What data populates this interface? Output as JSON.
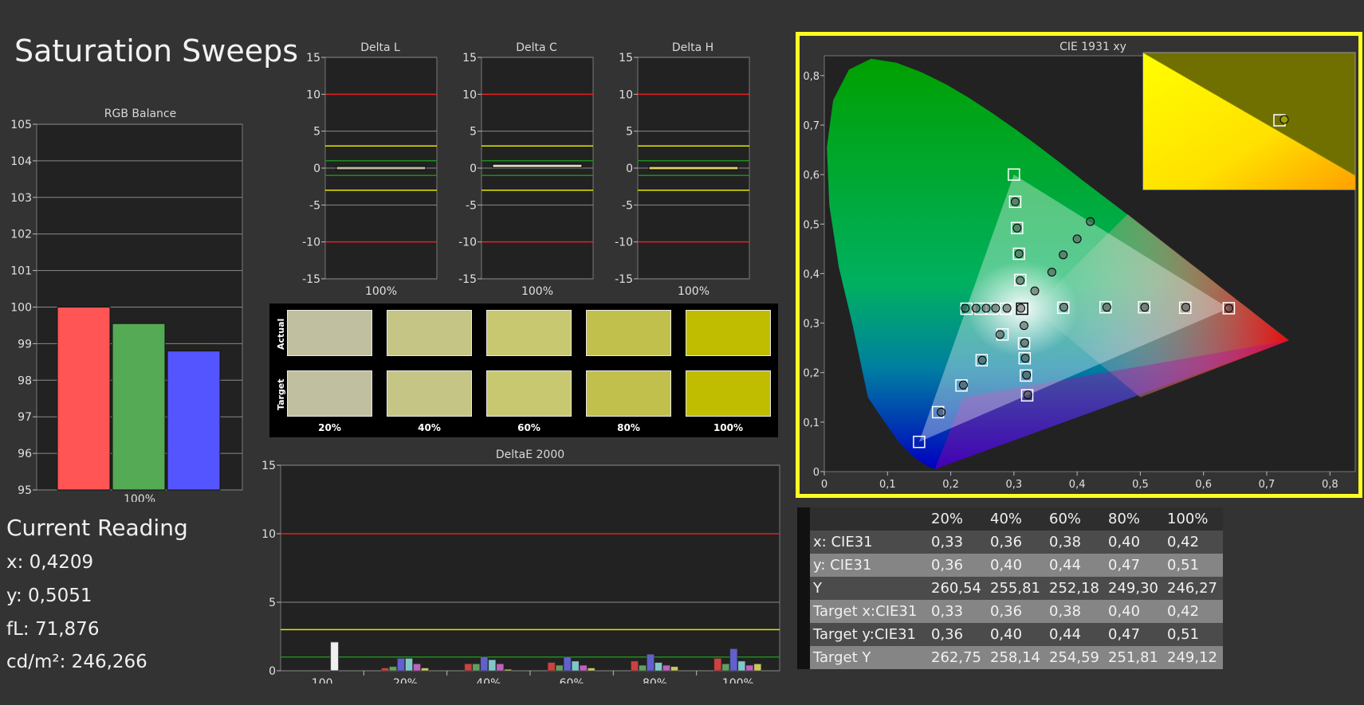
{
  "page": {
    "title": "Saturation Sweeps"
  },
  "colors": {
    "background": "#333333",
    "plot_background": "#222222",
    "highlight_border": "#ffff22",
    "red_limit": "#e02020",
    "yellow_limit": "#e6e600",
    "green_limit": "#1e8c1e"
  },
  "rgb_balance": {
    "title": "RGB Balance",
    "y_ticks": [
      "105",
      "104",
      "103",
      "102",
      "101",
      "100",
      "99",
      "98",
      "97",
      "96",
      "95"
    ],
    "x_label": "100%",
    "chart_data": {
      "type": "bar",
      "categories": [
        "R",
        "G",
        "B"
      ],
      "values": [
        100.0,
        99.55,
        98.8
      ],
      "colors": [
        "#ff5555",
        "#55aa55",
        "#5555ff"
      ],
      "ylim": [
        95,
        105
      ]
    }
  },
  "delta_charts": [
    {
      "title": "Delta L",
      "x_label": "100%",
      "chart_data": {
        "type": "bar",
        "categories": [
          "100%"
        ],
        "values": [
          0.0
        ],
        "bar_color": "#b8b8a0",
        "ylim": [
          -15,
          15
        ]
      }
    },
    {
      "title": "Delta C",
      "x_label": "100%",
      "chart_data": {
        "type": "bar",
        "categories": [
          "100%"
        ],
        "values": [
          0.3
        ],
        "bar_color": "#d8d8c0",
        "ylim": [
          -15,
          15
        ]
      }
    },
    {
      "title": "Delta H",
      "x_label": "100%",
      "chart_data": {
        "type": "bar",
        "categories": [
          "100%"
        ],
        "values": [
          0.0
        ],
        "bar_color": "#d8d060",
        "ylim": [
          -15,
          15
        ]
      }
    }
  ],
  "delta_ticks": [
    "15",
    "10",
    "5",
    "0",
    "-5",
    "-10",
    "-15"
  ],
  "swatches": {
    "actual_label": "Actual",
    "target_label": "Target",
    "labels": [
      "20%",
      "40%",
      "60%",
      "80%",
      "100%"
    ],
    "actual_colors": [
      "#c0c0a0",
      "#c5c585",
      "#c8c870",
      "#c2c04d",
      "#c0bc00"
    ],
    "target_colors": [
      "#c0c0a0",
      "#c5c585",
      "#c8c870",
      "#c2c04d",
      "#c0bc00"
    ]
  },
  "deltae": {
    "title": "DeltaE 2000",
    "y_ticks": [
      "15",
      "10",
      "5",
      "0"
    ],
    "chart_data": {
      "type": "bar",
      "ylim": [
        0,
        15
      ],
      "categories": [
        "100",
        "20%",
        "40%",
        "60%",
        "80%",
        "100%"
      ],
      "series": [
        {
          "name": "White",
          "color": "#f0f0f0",
          "values": [
            2.1,
            null,
            null,
            null,
            null,
            null
          ]
        },
        {
          "name": "Red",
          "color": "#d04040",
          "values": [
            null,
            0.2,
            0.5,
            0.6,
            0.7,
            0.9
          ]
        },
        {
          "name": "Green",
          "color": "#60a060",
          "values": [
            null,
            0.3,
            0.5,
            0.4,
            0.4,
            0.5
          ]
        },
        {
          "name": "Blue",
          "color": "#6060d0",
          "values": [
            null,
            0.9,
            1.0,
            1.0,
            1.2,
            1.6
          ]
        },
        {
          "name": "Cyan",
          "color": "#80c8c8",
          "values": [
            null,
            0.9,
            0.8,
            0.7,
            0.6,
            0.7
          ]
        },
        {
          "name": "Magenta",
          "color": "#c060c0",
          "values": [
            null,
            0.5,
            0.5,
            0.4,
            0.4,
            0.4
          ]
        },
        {
          "name": "Yellow",
          "color": "#c8c860",
          "values": [
            null,
            0.2,
            0.1,
            0.2,
            0.3,
            0.5
          ]
        }
      ]
    }
  },
  "current_reading": {
    "heading": "Current Reading",
    "x": "x: 0,4209",
    "y": "y: 0,5051",
    "fl": "fL: 71,876",
    "cdm2": "cd/m²: 246,266"
  },
  "cie": {
    "title": "CIE 1931 xy",
    "x_ticks": [
      "0",
      "0,1",
      "0,2",
      "0,3",
      "0,4",
      "0,5",
      "0,6",
      "0,7",
      "0,8"
    ],
    "y_ticks": [
      "0",
      "0,1",
      "0,2",
      "0,3",
      "0,4",
      "0,5",
      "0,6",
      "0,7",
      "0,8"
    ],
    "chart_data": {
      "type": "scatter",
      "xlim": [
        0,
        0.84
      ],
      "ylim": [
        0,
        0.84
      ],
      "gamut": [
        [
          0.64,
          0.33
        ],
        [
          0.3,
          0.6
        ],
        [
          0.15,
          0.06
        ]
      ],
      "white": [
        0.313,
        0.329
      ],
      "targets": [
        [
          0.64,
          0.33
        ],
        [
          0.571,
          0.331
        ],
        [
          0.506,
          0.332
        ],
        [
          0.445,
          0.332
        ],
        [
          0.378,
          0.331
        ],
        [
          0.3,
          0.6
        ],
        [
          0.302,
          0.545
        ],
        [
          0.305,
          0.492
        ],
        [
          0.308,
          0.44
        ],
        [
          0.31,
          0.387
        ],
        [
          0.15,
          0.06
        ],
        [
          0.18,
          0.12
        ],
        [
          0.217,
          0.174
        ],
        [
          0.249,
          0.225
        ],
        [
          0.282,
          0.277
        ],
        [
          0.225,
          0.329
        ],
        [
          0.247,
          0.329
        ],
        [
          0.266,
          0.329
        ],
        [
          0.287,
          0.329
        ],
        [
          0.321,
          0.154
        ],
        [
          0.319,
          0.194
        ],
        [
          0.317,
          0.229
        ],
        [
          0.316,
          0.259
        ],
        [
          0.313,
          0.329
        ]
      ],
      "measured": [
        [
          0.64,
          0.33
        ],
        [
          0.572,
          0.332
        ],
        [
          0.507,
          0.332
        ],
        [
          0.447,
          0.332
        ],
        [
          0.379,
          0.332
        ],
        [
          0.302,
          0.545
        ],
        [
          0.305,
          0.492
        ],
        [
          0.308,
          0.44
        ],
        [
          0.31,
          0.386
        ],
        [
          0.185,
          0.12
        ],
        [
          0.22,
          0.175
        ],
        [
          0.25,
          0.225
        ],
        [
          0.278,
          0.277
        ],
        [
          0.223,
          0.33
        ],
        [
          0.24,
          0.33
        ],
        [
          0.256,
          0.33
        ],
        [
          0.271,
          0.33
        ],
        [
          0.289,
          0.33
        ],
        [
          0.311,
          0.33
        ],
        [
          0.322,
          0.155
        ],
        [
          0.32,
          0.195
        ],
        [
          0.318,
          0.229
        ],
        [
          0.317,
          0.26
        ],
        [
          0.316,
          0.295
        ],
        [
          0.333,
          0.365
        ],
        [
          0.36,
          0.403
        ],
        [
          0.378,
          0.438
        ],
        [
          0.4,
          0.47
        ],
        [
          0.4209,
          0.5051
        ]
      ]
    }
  },
  "table": {
    "headers": [
      "20%",
      "40%",
      "60%",
      "80%",
      "100%"
    ],
    "rows": [
      {
        "label": "x: CIE31",
        "values": [
          "0,33",
          "0,36",
          "0,38",
          "0,40",
          "0,42"
        ]
      },
      {
        "label": "y: CIE31",
        "values": [
          "0,36",
          "0,40",
          "0,44",
          "0,47",
          "0,51"
        ]
      },
      {
        "label": "Y",
        "values": [
          "260,54",
          "255,81",
          "252,18",
          "249,30",
          "246,27"
        ]
      },
      {
        "label": "Target x:CIE31",
        "values": [
          "0,33",
          "0,36",
          "0,38",
          "0,40",
          "0,42"
        ]
      },
      {
        "label": "Target y:CIE31",
        "values": [
          "0,36",
          "0,40",
          "0,44",
          "0,47",
          "0,51"
        ]
      },
      {
        "label": "Target Y",
        "values": [
          "262,75",
          "258,14",
          "254,59",
          "251,81",
          "249,12"
        ]
      }
    ]
  }
}
